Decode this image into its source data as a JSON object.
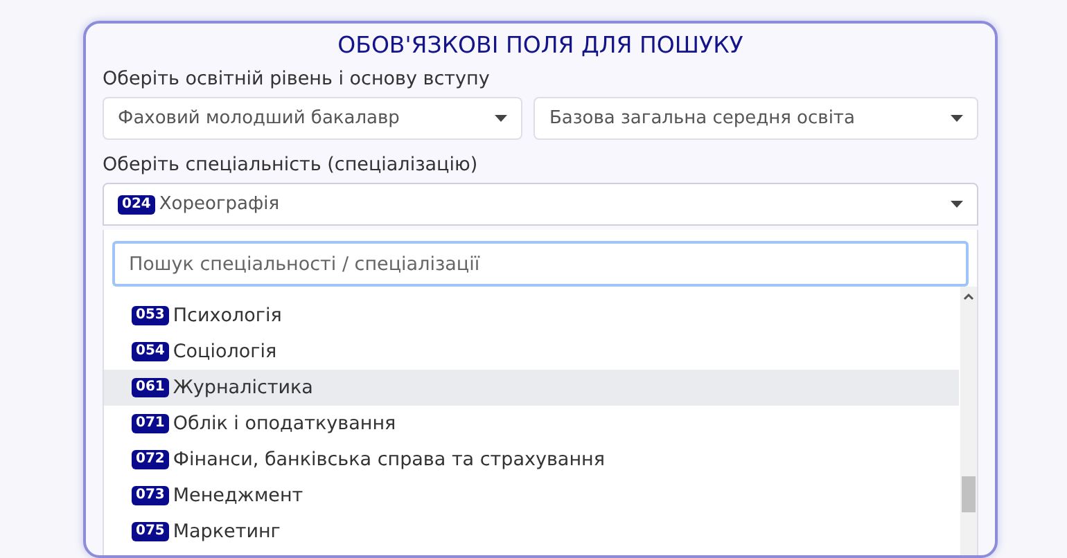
{
  "panel": {
    "title": "ОБОВ'ЯЗКОВІ ПОЛЯ ДЛЯ ПОШУКУ",
    "level_label": "Оберіть освітній рівень і основу вступу",
    "level_selects": [
      {
        "value": "Фаховий молодший бакалавр"
      },
      {
        "value": "Базова загальна середня освіта"
      }
    ],
    "specialty_label": "Оберіть спеціальність (спеціалізацію)",
    "specialty_select": {
      "code": "024",
      "value": "Хореографія",
      "expanded": true
    },
    "dropdown": {
      "search": {
        "placeholder": "Пошук спеціальності / спеціалізації"
      },
      "options": [
        {
          "code": "053",
          "name": "Психологія",
          "selected": false
        },
        {
          "code": "054",
          "name": "Соціологія",
          "selected": false
        },
        {
          "code": "061",
          "name": "Журналістика",
          "selected": true
        },
        {
          "code": "071",
          "name": "Облік і оподаткування",
          "selected": false
        },
        {
          "code": "072",
          "name": "Фінанси, банківська справа та страхування",
          "selected": false
        },
        {
          "code": "073",
          "name": "Менеджмент",
          "selected": false
        },
        {
          "code": "075",
          "name": "Маркетинг",
          "selected": false
        }
      ]
    }
  }
}
